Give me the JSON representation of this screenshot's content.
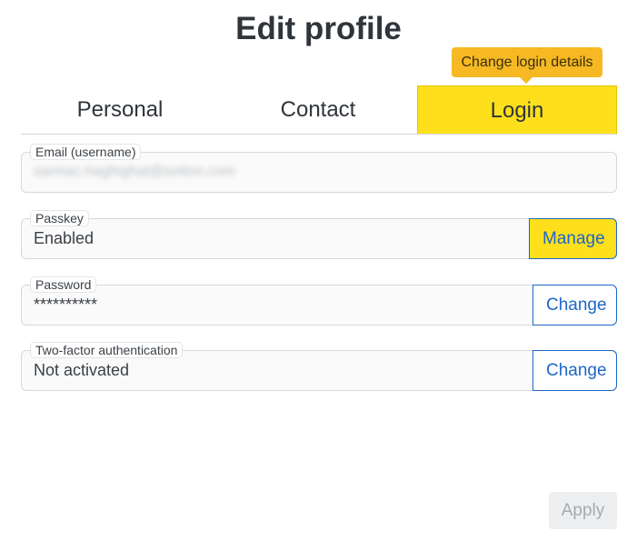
{
  "dialog": {
    "title": "Edit profile",
    "tooltip": "Change login details"
  },
  "tabs": [
    {
      "label": "Personal",
      "active": false
    },
    {
      "label": "Contact",
      "active": false
    },
    {
      "label": "Login",
      "active": true
    }
  ],
  "fields": {
    "email": {
      "label": "Email (username)",
      "value": "sarmac.haghighat@sotton.com"
    },
    "passkey": {
      "label": "Passkey",
      "value": "Enabled",
      "button": "Manage"
    },
    "password": {
      "label": "Password",
      "value": "**********",
      "button": "Change"
    },
    "two_factor": {
      "label": "Two-factor authentication",
      "value": "Not activated",
      "button": "Change"
    }
  },
  "footer": {
    "apply_label": "Apply"
  },
  "colors": {
    "active_tab": "#fde01b",
    "tooltip": "#f6b924",
    "link_blue": "#1e66c8"
  }
}
